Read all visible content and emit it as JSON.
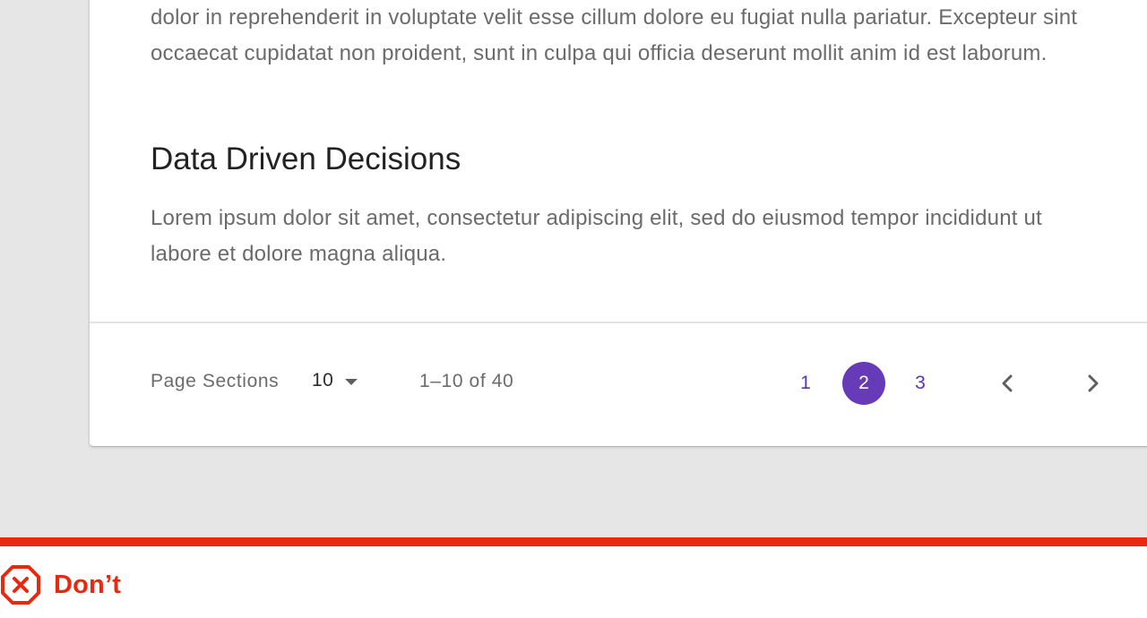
{
  "content": {
    "paragraph_top": "dolor in reprehenderit in voluptate velit esse cillum dolore eu fugiat nulla pariatur. Excepteur sint occaecat cupidatat non proident, sunt in culpa qui officia deserunt mollit anim id est laborum.",
    "heading": "Data Driven Decisions",
    "paragraph_bottom": "Lorem ipsum dolor sit amet, consectetur adipiscing elit, sed do eiusmod tempor incididunt ut labore et dolore magna aliqua."
  },
  "pagination": {
    "rows_label": "Page Sections",
    "rows_value": "10",
    "range": "1–10 of 40",
    "pages": [
      "1",
      "2",
      "3"
    ],
    "current_page": "2",
    "accent_color": "#673ab7",
    "prev_icon": "chevron-left-icon",
    "next_icon": "chevron-right-icon"
  },
  "guideline": {
    "label": "Don’t",
    "icon": "cancel-octagon-icon",
    "color": "#e8290f"
  }
}
